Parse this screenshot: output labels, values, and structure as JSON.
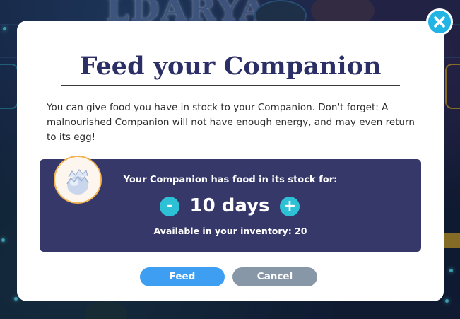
{
  "background": {
    "logo_text": "LDARYA"
  },
  "modal": {
    "title": "Feed your Companion",
    "description": "You can give food you have in stock to your Companion. Don't forget: A malnourished Companion will not have enough energy, and may even return to its egg!",
    "panel": {
      "stock_label": "Your Companion has food in its stock for:",
      "days_value": "10 days",
      "minus_label": "-",
      "plus_label": "+",
      "inventory_label": "Available in your inventory: 20"
    },
    "buttons": {
      "feed_label": "Feed",
      "cancel_label": "Cancel"
    },
    "close_icon": "close-icon"
  },
  "colors": {
    "title": "#2b2f66",
    "panel_bg": "#363869",
    "stepper_button": "#2ec1d6",
    "feed_button": "#3d9ef2",
    "cancel_button": "#8797a8",
    "close_button": "#21b4e4",
    "egg_border": "#f3b254"
  }
}
